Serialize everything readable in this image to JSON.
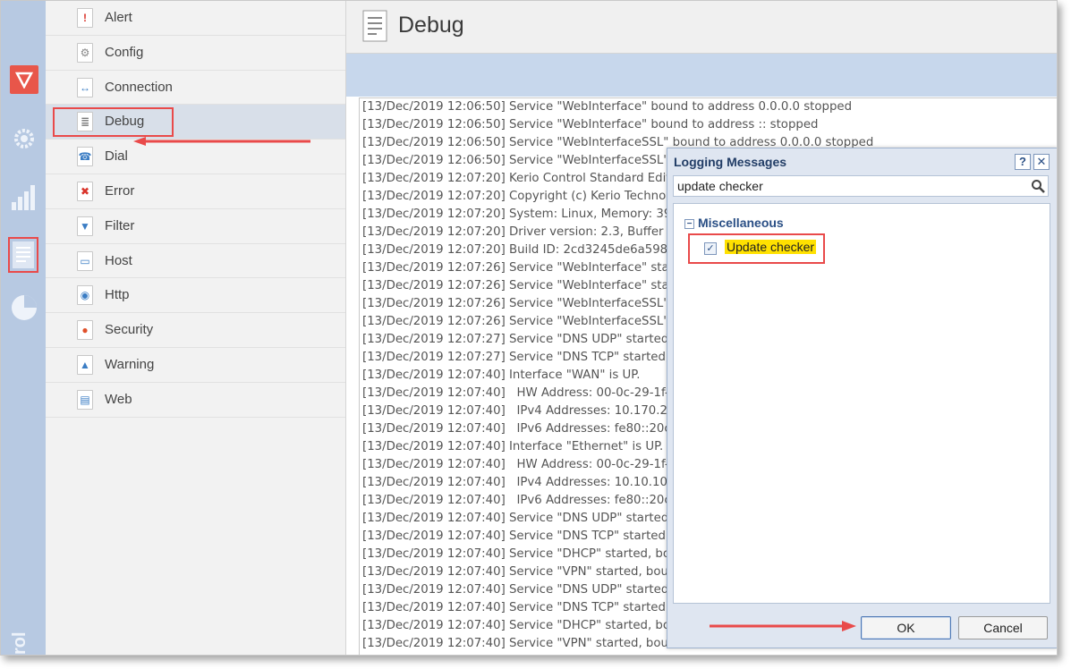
{
  "rail": {
    "brand_text": "rol",
    "icons": [
      "shield-icon",
      "gear-icon",
      "statistics-icon",
      "logs-icon",
      "pie-chart-icon"
    ]
  },
  "log_types": [
    {
      "label": "Alert",
      "icon": "alert-icon",
      "glyph": "!",
      "color": "#d9342b"
    },
    {
      "label": "Config",
      "icon": "config-icon",
      "glyph": "⚙",
      "color": "#888888"
    },
    {
      "label": "Connection",
      "icon": "connection-icon",
      "glyph": "↔",
      "color": "#3b7dc4"
    },
    {
      "label": "Debug",
      "icon": "debug-icon",
      "glyph": "≣",
      "color": "#777777"
    },
    {
      "label": "Dial",
      "icon": "dial-icon",
      "glyph": "☎",
      "color": "#3b7dc4"
    },
    {
      "label": "Error",
      "icon": "error-icon",
      "glyph": "✖",
      "color": "#d9342b"
    },
    {
      "label": "Filter",
      "icon": "filter-icon",
      "glyph": "▼",
      "color": "#3b7dc4"
    },
    {
      "label": "Host",
      "icon": "host-icon",
      "glyph": "▭",
      "color": "#3b7dc4"
    },
    {
      "label": "Http",
      "icon": "http-icon",
      "glyph": "◉",
      "color": "#3b7dc4"
    },
    {
      "label": "Security",
      "icon": "security-icon",
      "glyph": "●",
      "color": "#e0502a"
    },
    {
      "label": "Warning",
      "icon": "warning-icon",
      "glyph": "▲",
      "color": "#3b7dc4"
    },
    {
      "label": "Web",
      "icon": "web-icon",
      "glyph": "▤",
      "color": "#3b7dc4"
    }
  ],
  "selected_log_type": "Debug",
  "header": {
    "title": "Debug"
  },
  "log_lines": [
    "[13/Dec/2019 12:06:50] Service \"WebInterface\" bound to address 0.0.0.0 stopped",
    "[13/Dec/2019 12:06:50] Service \"WebInterface\" bound to address :: stopped",
    "[13/Dec/2019 12:06:50] Service \"WebInterfaceSSL\" bound to address 0.0.0.0 stopped",
    "[13/Dec/2019 12:06:50] Service \"WebInterfaceSSL\" bo",
    "[13/Dec/2019 12:07:20] Kerio Control Standard Edition",
    "[13/Dec/2019 12:07:20] Copyright (c) Kerio Technologie",
    "[13/Dec/2019 12:07:20] System: Linux, Memory: 3965",
    "[13/Dec/2019 12:07:20] Driver version: 2.3, Buffer size",
    "[13/Dec/2019 12:07:20] Build ID: 2cd3245de6a598baca",
    "[13/Dec/2019 12:07:26] Service \"WebInterface\" started",
    "[13/Dec/2019 12:07:26] Service \"WebInterface\" started",
    "[13/Dec/2019 12:07:26] Service \"WebInterfaceSSL\" sta",
    "[13/Dec/2019 12:07:26] Service \"WebInterfaceSSL\" sta",
    "[13/Dec/2019 12:07:27] Service \"DNS UDP\" started, bo",
    "[13/Dec/2019 12:07:27] Service \"DNS TCP\" started, bo",
    "[13/Dec/2019 12:07:40] Interface \"WAN\" is UP.",
    "[13/Dec/2019 12:07:40]   HW Address: 00-0c-29-1f-f9-",
    "[13/Dec/2019 12:07:40]   IPv4 Addresses: 10.170.29.1",
    "[13/Dec/2019 12:07:40]   IPv6 Addresses: fe80::20c:29",
    "[13/Dec/2019 12:07:40] Interface \"Ethernet\" is UP.",
    "[13/Dec/2019 12:07:40]   HW Address: 00-0c-29-1f-f9-",
    "[13/Dec/2019 12:07:40]   IPv4 Addresses: 10.10.10.1/2",
    "[13/Dec/2019 12:07:40]   IPv6 Addresses: fe80::20c:29",
    "[13/Dec/2019 12:07:40] Service \"DNS UDP\" started, bo",
    "[13/Dec/2019 12:07:40] Service \"DNS TCP\" started, bou",
    "[13/Dec/2019 12:07:40] Service \"DHCP\" started, bound",
    "[13/Dec/2019 12:07:40] Service \"VPN\" started, bound t",
    "[13/Dec/2019 12:07:40] Service \"DNS UDP\" started, bo",
    "[13/Dec/2019 12:07:40] Service \"DNS TCP\" started, bo",
    "[13/Dec/2019 12:07:40] Service \"DHCP\" started, bound",
    "[13/Dec/2019 12:07:40] Service \"VPN\" started, bound t"
  ],
  "dialog": {
    "title": "Logging Messages",
    "help_label": "?",
    "close_label": "✕",
    "search_value": "update checker",
    "category": "Miscellaneous",
    "item_label": "Update checker",
    "item_checked": true,
    "ok_label": "OK",
    "cancel_label": "Cancel"
  },
  "colors": {
    "rail_bg": "#b7c9e2",
    "annotation_red": "#e94a4a",
    "highlight_yellow": "#ffe100",
    "dialog_title": "#223d66"
  }
}
